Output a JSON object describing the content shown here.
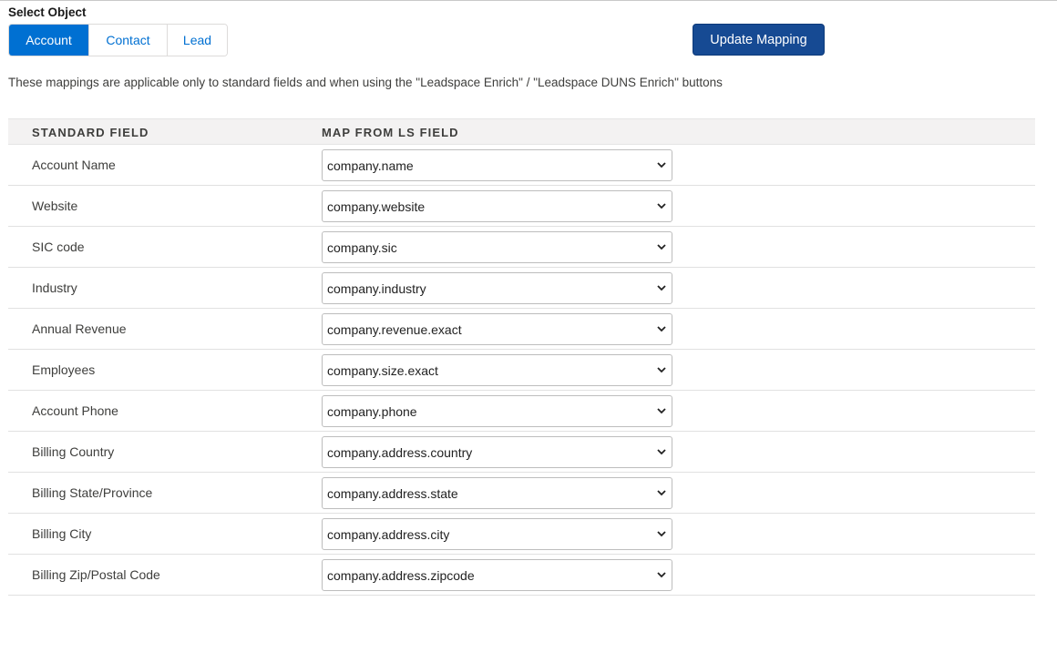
{
  "select_object": {
    "label": "Select Object",
    "tabs": [
      {
        "label": "Account",
        "active": true
      },
      {
        "label": "Contact",
        "active": false
      },
      {
        "label": "Lead",
        "active": false
      }
    ]
  },
  "update_button": {
    "label": "Update Mapping"
  },
  "note": "These mappings are applicable only to standard fields and when using the \"Leadspace Enrich\" / \"Leadspace DUNS Enrich\" buttons",
  "table": {
    "headers": {
      "standard_field": "STANDARD FIELD",
      "map_from": "MAP FROM LS FIELD"
    },
    "rows": [
      {
        "field": "Account Name",
        "mapping": "company.name"
      },
      {
        "field": "Website",
        "mapping": "company.website"
      },
      {
        "field": "SIC code",
        "mapping": "company.sic"
      },
      {
        "field": "Industry",
        "mapping": "company.industry"
      },
      {
        "field": "Annual Revenue",
        "mapping": "company.revenue.exact"
      },
      {
        "field": "Employees",
        "mapping": "company.size.exact"
      },
      {
        "field": "Account Phone",
        "mapping": "company.phone"
      },
      {
        "field": "Billing Country",
        "mapping": "company.address.country"
      },
      {
        "field": "Billing State/Province",
        "mapping": "company.address.state"
      },
      {
        "field": "Billing City",
        "mapping": "company.address.city"
      },
      {
        "field": "Billing Zip/Postal Code",
        "mapping": "company.address.zipcode"
      }
    ]
  },
  "colors": {
    "accent": "#0070d2",
    "button": "#164a93",
    "header_bg": "#f3f2f2"
  },
  "icons": {
    "select_arrow": "chevron-down-icon"
  }
}
